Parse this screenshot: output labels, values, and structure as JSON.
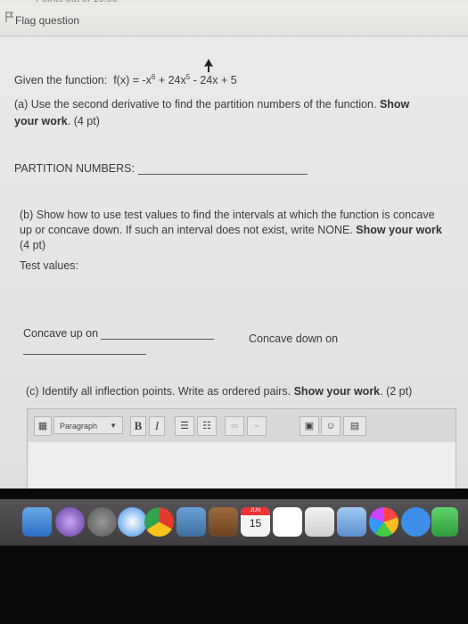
{
  "flag": {
    "label": "Flag question"
  },
  "question": {
    "given_prefix": "Given the function:",
    "func_a": "f(x) = -x",
    "exp6": "6",
    "func_b": " + 24x",
    "exp5": "5",
    "func_c": " - 24x + 5",
    "part_a_line1_pre": "(a) Use the second derivative to find the partition numbers of the function. ",
    "part_a_line1_bold": "Show",
    "part_a_line2_bold": "your work",
    "part_a_line2_post": ". (4 pt)",
    "partition_label": "PARTITION NUMBERS:",
    "part_b_line1": "(b) Show how to use test values to find the intervals at which the function is concave",
    "part_b_line2_pre": "up or concave down. If such an interval does not exist, write NONE. ",
    "part_b_line2_bold": "Show your work",
    "part_b_line3": "(4 pt)",
    "test_values": "Test values:",
    "concave_up": "Concave up on",
    "concave_down": "Concave down on",
    "part_c_pre": "(c) Identify all inflection points. Write as ordered pairs. ",
    "part_c_bold": "Show your work",
    "part_c_post": ". (2 pt)"
  },
  "editor": {
    "format_select": "Paragraph",
    "bold": "B",
    "italic": "I"
  },
  "dock": {
    "calendar_month": "JUN",
    "calendar_day": "15"
  }
}
